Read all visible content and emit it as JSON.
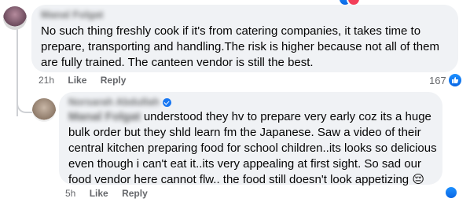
{
  "comments": [
    {
      "author": "Manal Folgat",
      "text": "No such thing freshly cook if it's from catering companies, it takes time to prepare, transporting and handling.The risk is higher because not all of them are fully trained. The canteen vendor is still the best.",
      "time": "21h",
      "like_label": "Like",
      "reply_label": "Reply",
      "reaction_count": "167"
    },
    {
      "author": "Norsarah Abdullah",
      "mention": "Manal Folgat",
      "text": " understood they hv to prepare very early coz its a huge bulk order but they shld learn fm the Japanese. Saw a video of their central kitchen preparing food for school children..its looks so delicious even though i can't eat it..its very appealing at first sight. So sad our food vendor here cannot flw.. the food still doesn't look appetizing ",
      "emoji": "😔",
      "time": "5h",
      "like_label": "Like",
      "reply_label": "Reply"
    }
  ],
  "colors": {
    "bubble": "#f0f2f5",
    "meta": "#65676b",
    "like_blue": "#1877f2"
  }
}
